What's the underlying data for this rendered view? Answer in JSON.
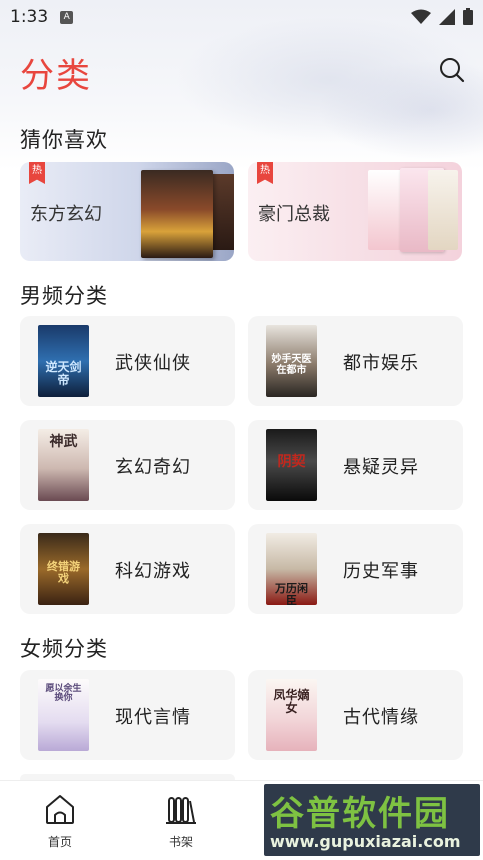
{
  "status_bar": {
    "time": "1:33",
    "notification_icon": "A"
  },
  "header": {
    "title": "分类"
  },
  "sections": {
    "guess": "猜你喜欢",
    "male": "男频分类",
    "female": "女频分类"
  },
  "banners": [
    {
      "label": "东方玄幻",
      "badge": "热"
    },
    {
      "label": "豪门总裁",
      "badge": "热"
    }
  ],
  "male_categories": [
    {
      "label": "武侠仙侠",
      "cover_text": "逆天剑帝"
    },
    {
      "label": "都市娱乐",
      "cover_text": "妙手天医在都市"
    },
    {
      "label": "玄幻奇幻",
      "cover_text": "神武"
    },
    {
      "label": "悬疑灵异",
      "cover_text": "阴契"
    },
    {
      "label": "科幻游戏",
      "cover_text": "终错游戏"
    },
    {
      "label": "历史军事",
      "cover_text": "万历闲臣"
    }
  ],
  "female_categories": [
    {
      "label": "现代言情",
      "cover_text": "愿以余生换你"
    },
    {
      "label": "古代情缘",
      "cover_text": "凤华嫡女"
    }
  ],
  "bottom_nav": [
    {
      "label": "首页",
      "icon": "home-icon"
    },
    {
      "label": "书架",
      "icon": "bookshelf-icon"
    }
  ],
  "watermark": {
    "title": "谷普软件园",
    "url": "www.gupuxiazai.com"
  },
  "colors": {
    "accent": "#e8463e",
    "card_bg": "#f5f5f5"
  }
}
